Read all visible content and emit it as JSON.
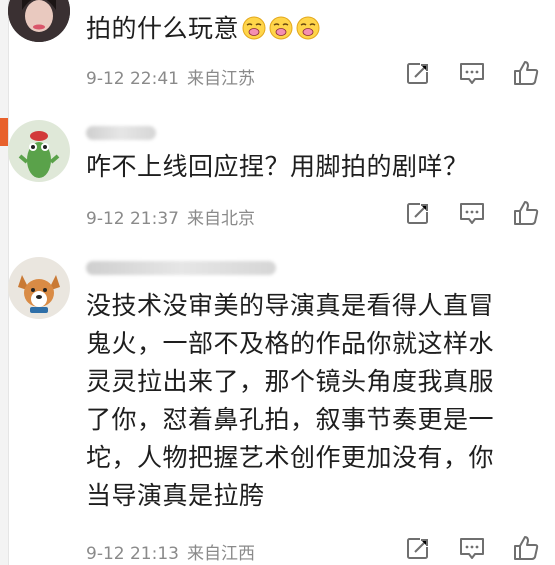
{
  "comments": [
    {
      "text": "拍的什么玩意",
      "emoji_count": 3,
      "emoji_icon": "yawning-face-emoji",
      "time": "9-12 22:41",
      "location": "来自江苏"
    },
    {
      "text": "咋不上线回应捏？用脚拍的剧咩？",
      "time": "9-12 21:37",
      "location": "来自北京"
    },
    {
      "text_lines": [
        "没技术没审美的导演真是看得人直冒",
        "鬼火，一部不及格的作品你就这样水",
        "灵灵拉出来了，那个镜头角度我真服",
        "了你，怼着鼻孔拍，叙事节奏更是一",
        "坨，人物把握艺术创作更加没有，你",
        "当导演真是拉胯"
      ],
      "time": "9-12 21:13",
      "location": "来自江西"
    }
  ],
  "action_icons": [
    "share-icon",
    "comment-icon",
    "like-icon"
  ],
  "colors": {
    "meta_text": "#8a8a8a",
    "body_text": "#1e1e1e",
    "accent": "#e8612c"
  }
}
